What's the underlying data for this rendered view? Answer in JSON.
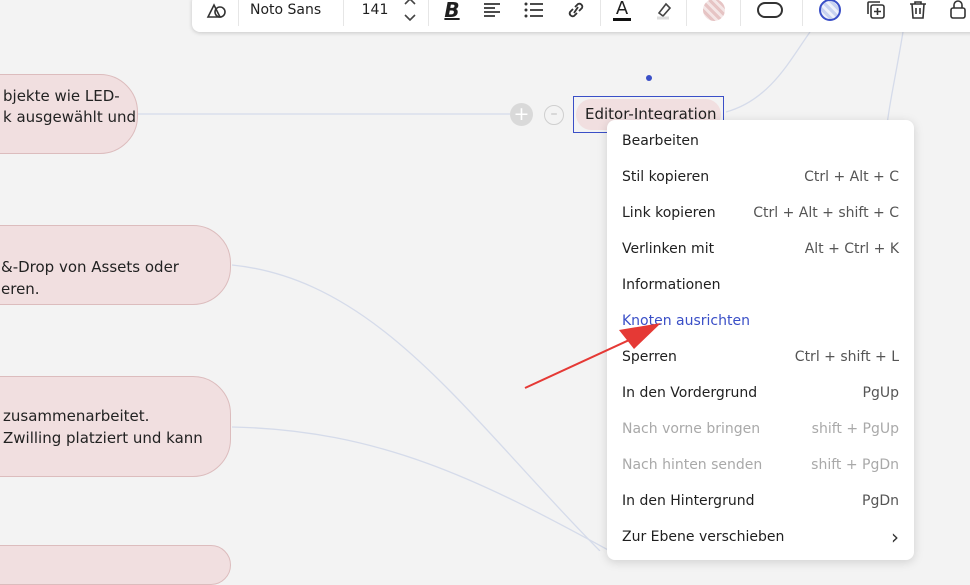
{
  "toolbar": {
    "font_family": "Noto Sans",
    "font_size": "141"
  },
  "canvas": {
    "nodes": [
      {
        "lines": [
          "bjekte wie LED-",
          "k ausgewählt und"
        ]
      },
      {
        "lines": [
          "&-Drop von Assets oder",
          "eren."
        ]
      },
      {
        "lines": [
          "zusammenarbeitet.",
          "Zwilling platziert und kann"
        ]
      }
    ],
    "selected_node": "Editor-Integration"
  },
  "context_menu": {
    "items": [
      {
        "label": "Bearbeiten",
        "shortcut": "",
        "state": "normal"
      },
      {
        "label": "Stil kopieren",
        "shortcut": "Ctrl + Alt + C",
        "state": "normal"
      },
      {
        "label": "Link kopieren",
        "shortcut": "Ctrl + Alt + shift + C",
        "state": "normal"
      },
      {
        "label": "Verlinken mit",
        "shortcut": "Alt + Ctrl + K",
        "state": "normal"
      },
      {
        "label": "Informationen",
        "shortcut": "",
        "state": "normal"
      },
      {
        "label": "Knoten ausrichten",
        "shortcut": "",
        "state": "active"
      },
      {
        "label": "Sperren",
        "shortcut": "Ctrl + shift + L",
        "state": "normal"
      },
      {
        "label": "In den Vordergrund",
        "shortcut": "PgUp",
        "state": "normal"
      },
      {
        "label": "Nach vorne bringen",
        "shortcut": "shift + PgUp",
        "state": "disabled"
      },
      {
        "label": "Nach hinten senden",
        "shortcut": "shift + PgDn",
        "state": "disabled"
      },
      {
        "label": "In den Hintergrund",
        "shortcut": "PgDn",
        "state": "normal"
      },
      {
        "label": "Zur Ebene verschieben",
        "shortcut": "›",
        "state": "submenu"
      }
    ]
  },
  "colors": {
    "node_fill": "#f1dfe0",
    "selection_blue": "#3a4fc7",
    "arrow_red": "#e53935"
  }
}
